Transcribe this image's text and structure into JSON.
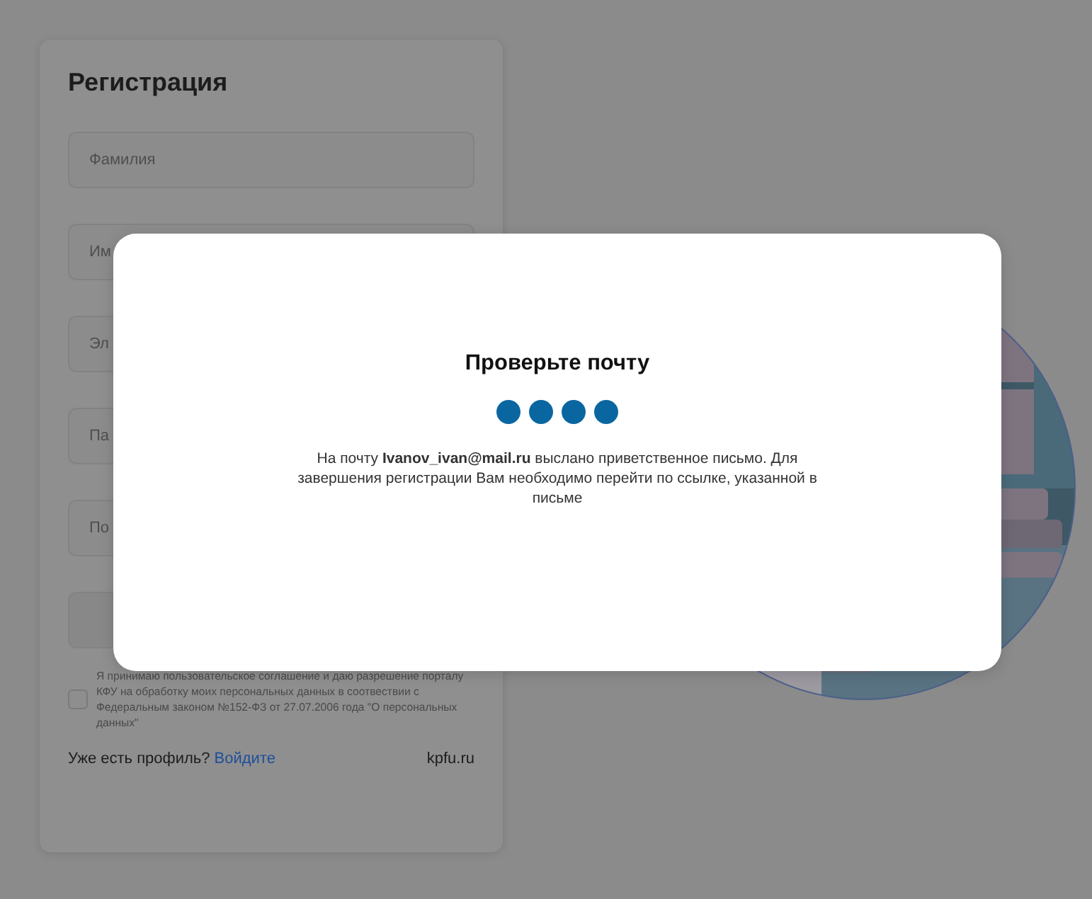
{
  "registration": {
    "title": "Регистрация",
    "fields": [
      {
        "placeholder": "Фамилия"
      },
      {
        "placeholder": "Им"
      },
      {
        "placeholder": "Эл"
      },
      {
        "placeholder": "Па"
      },
      {
        "placeholder": "По"
      }
    ],
    "consent": {
      "checked": false,
      "text": "Я принимаю пользовательское соглашение и даю разрешение порталу КФУ на обработку моих персональных данных в соотвествии с Федеральным законом №152-ФЗ от 27.07.2006 года \"О персональных данных\""
    },
    "footer": {
      "question": "Уже есть профиль?",
      "login_link": "Войдите",
      "site": "kpfu.ru"
    }
  },
  "modal": {
    "title": "Проверьте почту",
    "message": "На почту **Ivanov_ivan@mail.ru** выслано приветственное письмо. Для завершения регистрации Вам необходимо перейти по ссылке, указанной в письме"
  }
}
